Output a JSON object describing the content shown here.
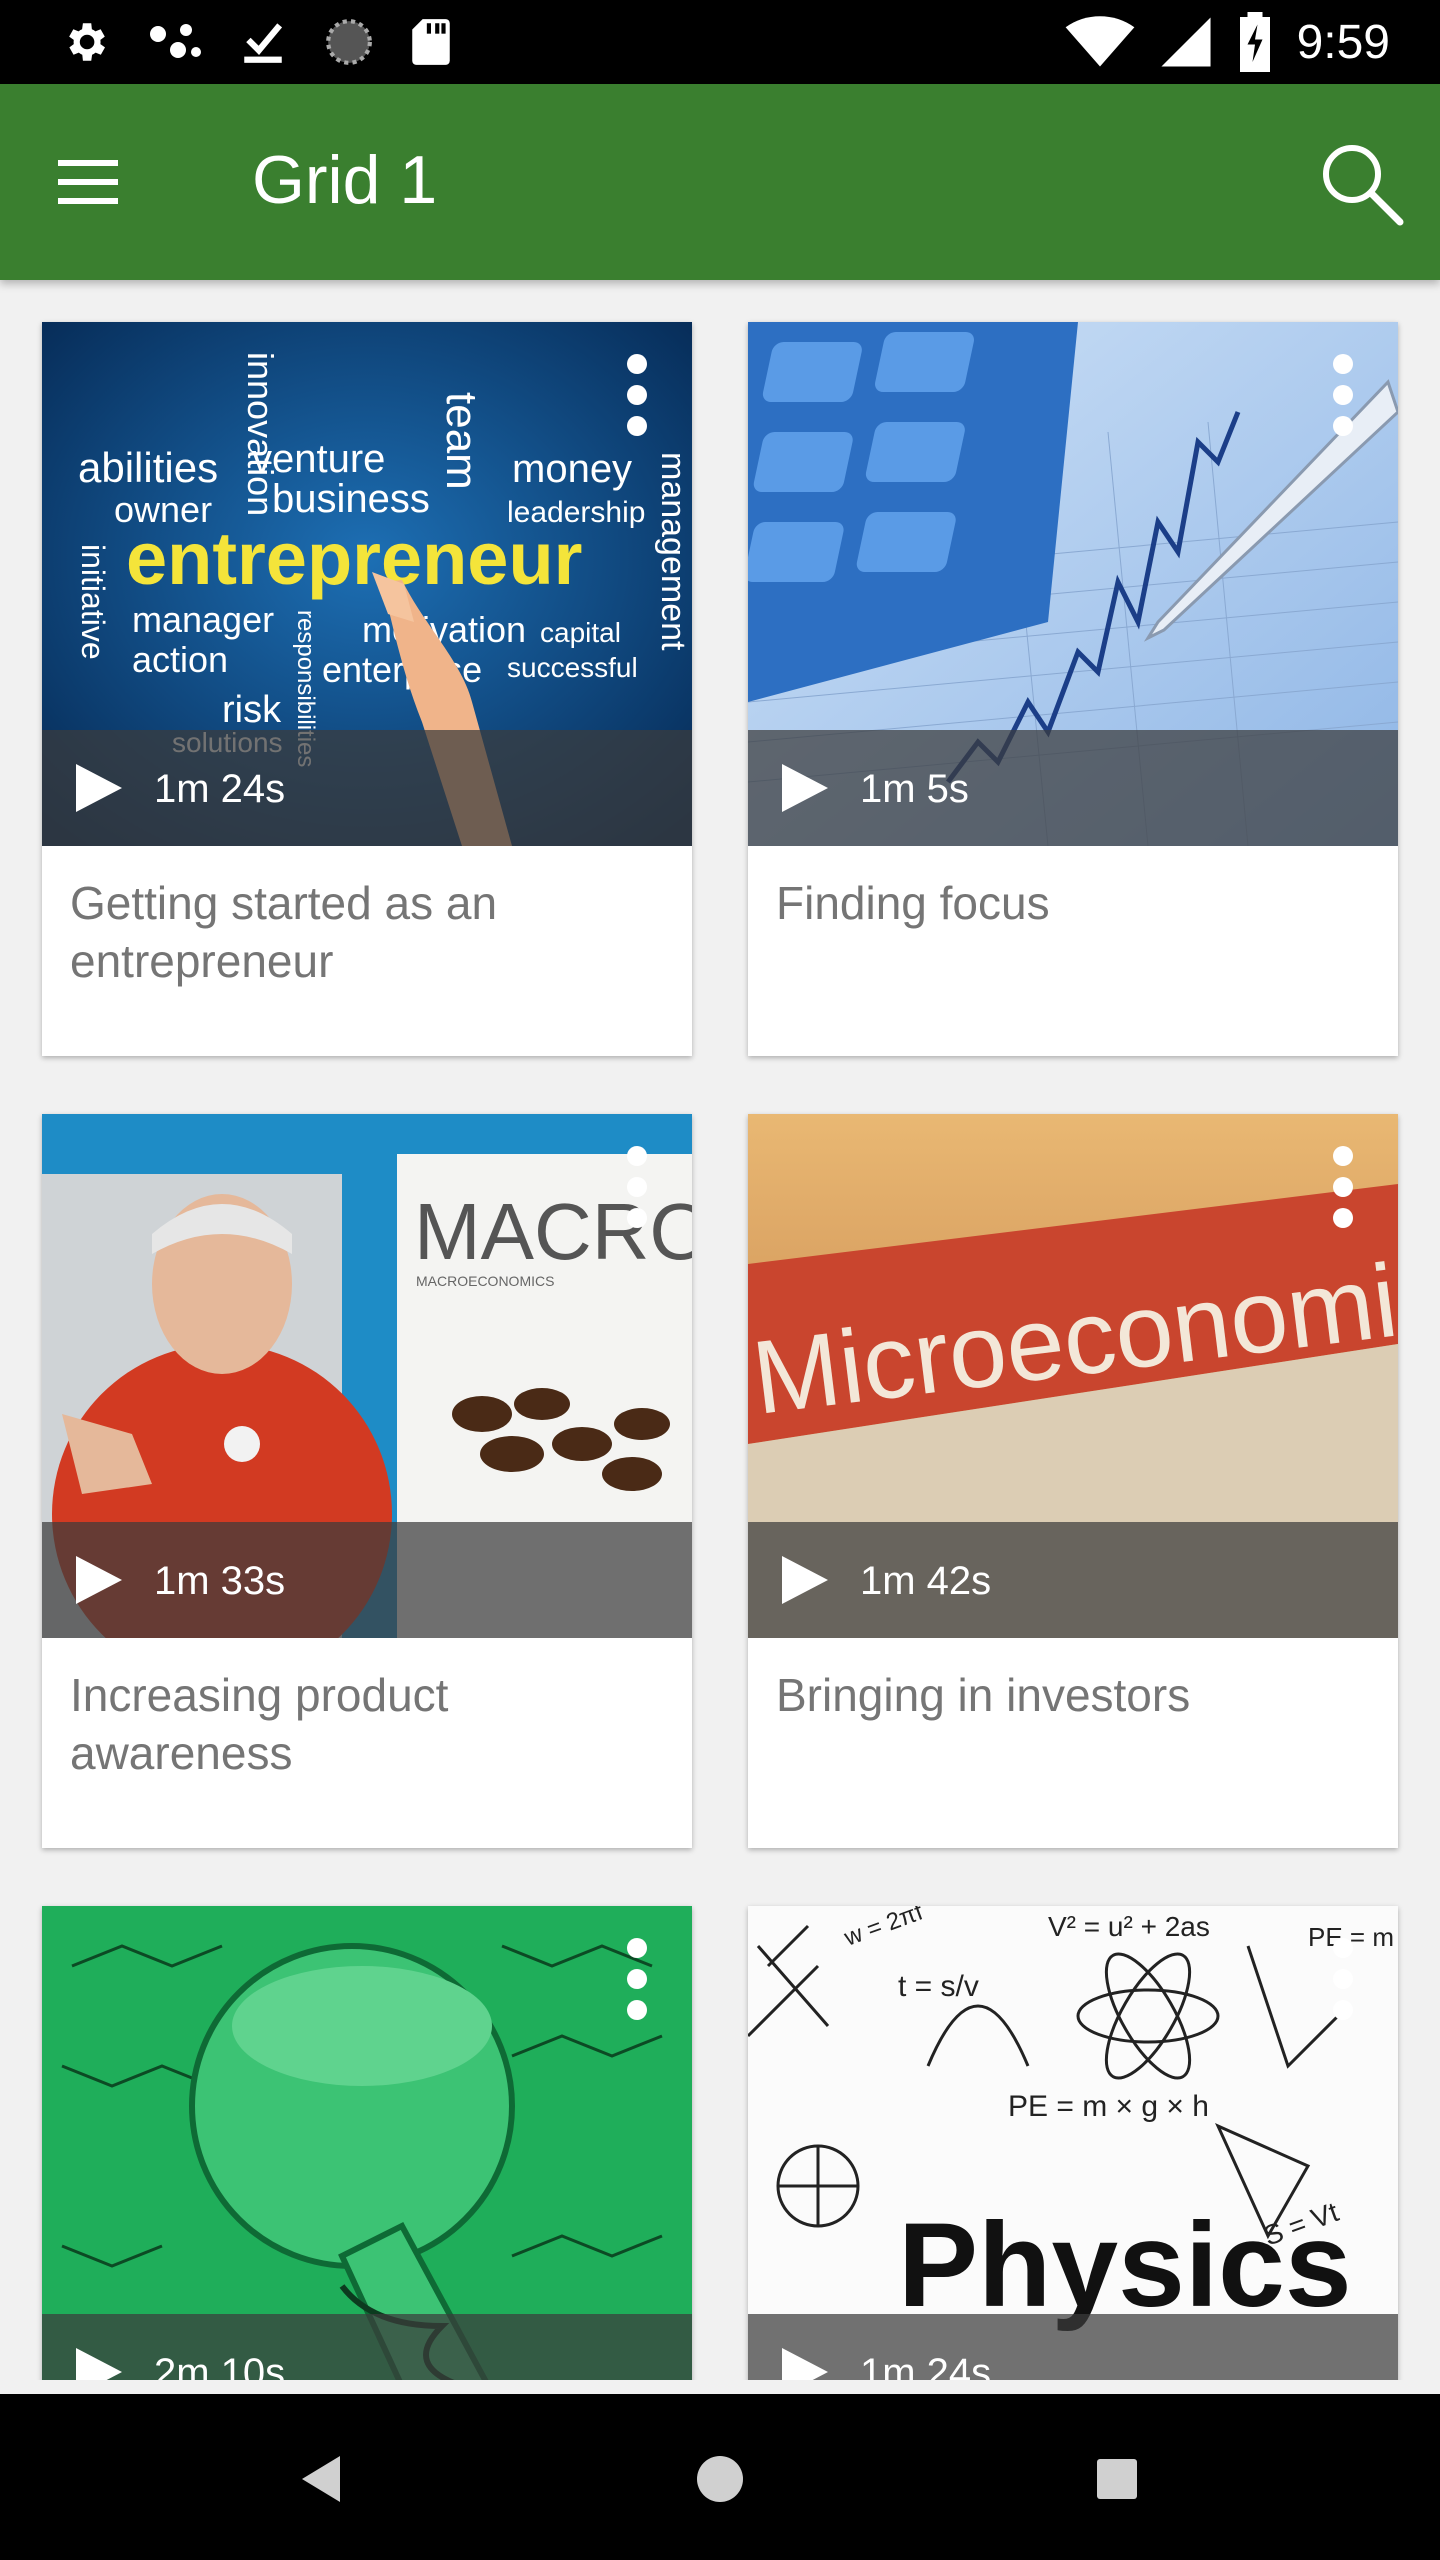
{
  "status_bar": {
    "time": "9:59",
    "left_icons": [
      "settings-icon",
      "network-dots-icon",
      "download-done-icon",
      "sync-icon",
      "sd-card-icon"
    ],
    "right_icons": [
      "wifi-icon",
      "signal-icon",
      "battery-charging-icon"
    ]
  },
  "app_bar": {
    "title": "Grid 1",
    "color": "#3a7f2f",
    "icons": [
      "menu-icon",
      "search-icon"
    ]
  },
  "cards": [
    {
      "title": "Getting started as an entrepreneur",
      "duration": "1m 24s"
    },
    {
      "title": "Finding focus",
      "duration": "1m 5s"
    },
    {
      "title": "Increasing product awareness",
      "duration": "1m 33s"
    },
    {
      "title": "Bringing in investors",
      "duration": "1m 42s"
    },
    {
      "title": "",
      "duration": "2m 10s"
    },
    {
      "title": "",
      "duration": "1m 24s"
    }
  ],
  "thumbnail_text": {
    "c1": {
      "big": "entrepreneur",
      "words": [
        "abilities",
        "owner",
        "innovation",
        "venture",
        "business",
        "team",
        "money",
        "leadership",
        "management",
        "initiative",
        "manager",
        "action",
        "risk",
        "solutions",
        "responsibilities",
        "motivation",
        "capital",
        "enterprise",
        "successful"
      ]
    },
    "c3": {
      "cover_title": "MACRO",
      "cover_sub": "MACROECONOMICS"
    },
    "c4": {
      "spine": "Microeconomics"
    },
    "c6": {
      "big": "Physics",
      "formulas": [
        "V² = u² + 2as",
        "PE = m × g × h",
        "S = Vt",
        "t = s/v",
        "w = 2πf",
        "PE = m"
      ]
    }
  },
  "nav_bar": {
    "buttons": [
      "back-icon",
      "home-icon",
      "recents-icon"
    ]
  }
}
